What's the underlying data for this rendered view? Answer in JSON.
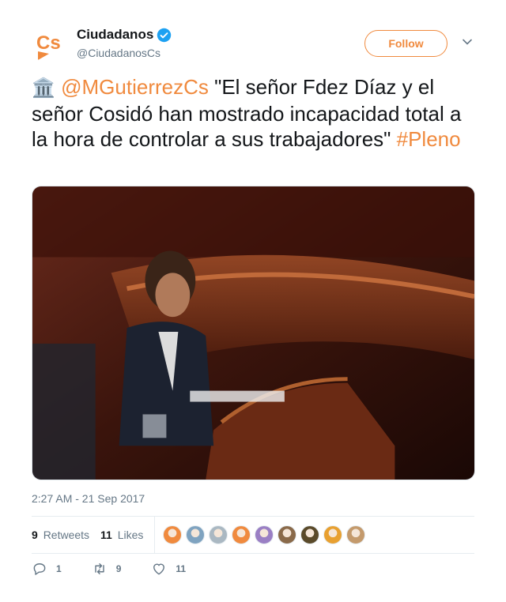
{
  "account": {
    "display_name": "Ciudadanos",
    "handle": "@CiudadanosCs",
    "verified": true,
    "brand_color": "#f08a3e",
    "avatar_text": "Cs"
  },
  "follow_button": {
    "label": "Follow"
  },
  "menu": {
    "icon": "chevron-down-icon"
  },
  "tweet": {
    "emoji": "🏛️",
    "mention": "@MGutierrezCs",
    "text": " \"El señor Fdez Díaz y el señor Cosidó han mostrado incapacidad total a la hora de controlar a sus trabajadores\" ",
    "hashtag": "#Pleno"
  },
  "media": {
    "type": "photo",
    "icon": "photo-parliament-speaker"
  },
  "timestamp": "2:27 AM - 21 Sep 2017",
  "stats": {
    "retweets_count": "9",
    "retweets_label": "Retweets",
    "likes_count": "11",
    "likes_label": "Likes"
  },
  "likers": [
    {
      "color": "#f08a3e"
    },
    {
      "color": "#7fa3c0"
    },
    {
      "color": "#aab8c2"
    },
    {
      "color": "#f08a3e"
    },
    {
      "color": "#9a7fc4"
    },
    {
      "color": "#8a6a4a"
    },
    {
      "color": "#5a4a2a"
    },
    {
      "color": "#e8a030"
    },
    {
      "color": "#c49a6c"
    }
  ],
  "actions": {
    "reply_count": "1",
    "retweet_count": "9",
    "like_count": "11"
  }
}
